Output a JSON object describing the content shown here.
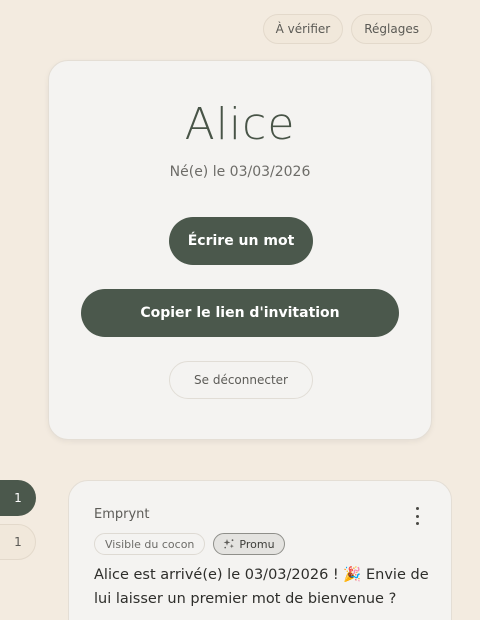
{
  "header": {
    "review_label": "À vérifier",
    "settings_label": "Réglages"
  },
  "profile": {
    "name": "Alice",
    "birth": "Né(e) le 03/03/2026",
    "write_label": "Écrire un mot",
    "copy_invite_label": "Copier le lien d'invitation",
    "logout_label": "Se déconnecter"
  },
  "side_tabs": [
    {
      "label": "1",
      "active": true
    },
    {
      "label": "1",
      "active": false
    }
  ],
  "post": {
    "author": "Emprynt",
    "visibility_badge": "Visible du cocon",
    "promo_badge": "Promu",
    "promo_icon": "sparkles-icon",
    "menu_icon": "more-vertical-icon",
    "text": "Alice est arrivé(e) le 03/03/2026 ! 🎉 Envie de lui laisser un premier mot de bienvenue ?"
  },
  "colors": {
    "background": "#f3ebe0",
    "card": "#f4f3f1",
    "accent_dark_green": "#4b584c",
    "name_color": "#485447"
  }
}
